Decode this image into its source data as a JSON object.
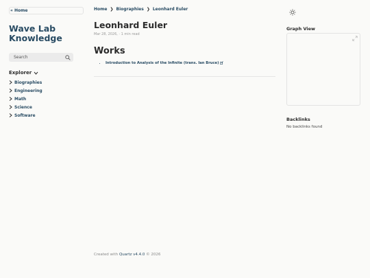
{
  "left": {
    "home_link": "« Home",
    "site_title_line1": "Wave Lab",
    "site_title_line2": "Knowledge",
    "search_placeholder": "Search",
    "explorer_label": "Explorer",
    "tree": [
      "Biographies",
      "Engineering",
      "Math",
      "Science",
      "Software"
    ]
  },
  "center": {
    "breadcrumb": [
      "Home",
      "Biographies",
      "Leonhard Euler"
    ],
    "breadcrumb_sep": "❯",
    "title": "Leonhard Euler",
    "meta": "Mar 28, 2026, · 1 min read",
    "section": "Works",
    "works": [
      "Introduction to Analysis of the Infinite (trans. Ian Bruce)"
    ]
  },
  "right": {
    "graph_title": "Graph View",
    "backlinks_title": "Backlinks",
    "backlinks_empty": "No backlinks found"
  },
  "footer": {
    "prefix": "Created with ",
    "link": "Quartz v4.4.0",
    "suffix": " © 2026"
  },
  "colors": {
    "accent": "#284b63",
    "background": "#fafaf8",
    "text": "#2b2b2b"
  }
}
